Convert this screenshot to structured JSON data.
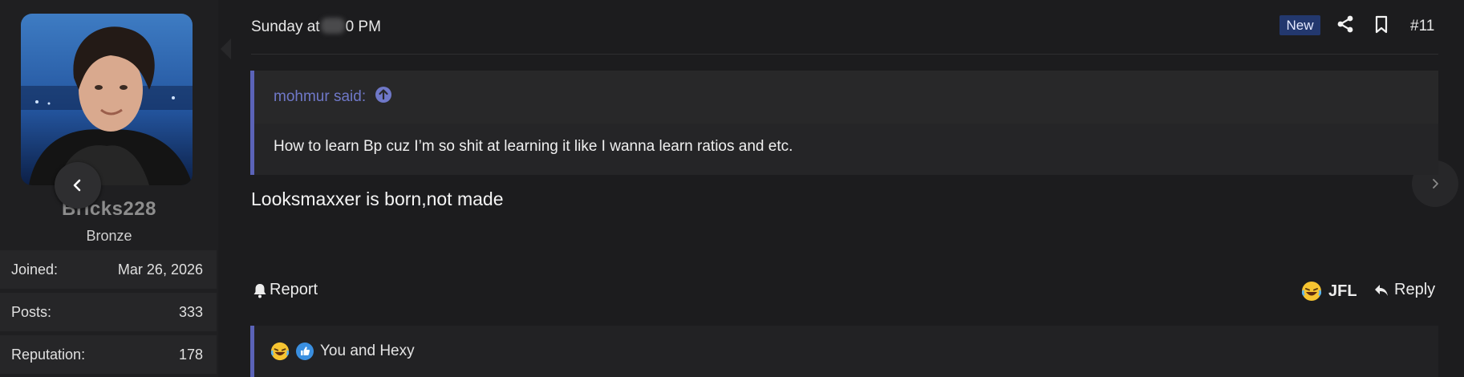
{
  "user": {
    "name": "Bricks228",
    "title": "Bronze",
    "stats": [
      {
        "label": "Joined:",
        "value": "Mar 26, 2026"
      },
      {
        "label": "Posts:",
        "value": "333"
      },
      {
        "label": "Reputation:",
        "value": "178"
      }
    ]
  },
  "post": {
    "date_prefix": "Sunday at",
    "date_suffix": "0 PM",
    "badge": "New",
    "number": "#11",
    "quote": {
      "author": "mohmur said:",
      "text": "How to learn Bp cuz I’m so shit at learning it like I wanna learn ratios and etc."
    },
    "message": "Looksmaxxer is born,not made"
  },
  "actions": {
    "report": "Report",
    "jfl": "JFL",
    "reply": "Reply"
  },
  "reactions": {
    "text": "You and Hexy"
  },
  "colors": {
    "accent": "#5b63b8",
    "badge_bg": "#23386e"
  }
}
